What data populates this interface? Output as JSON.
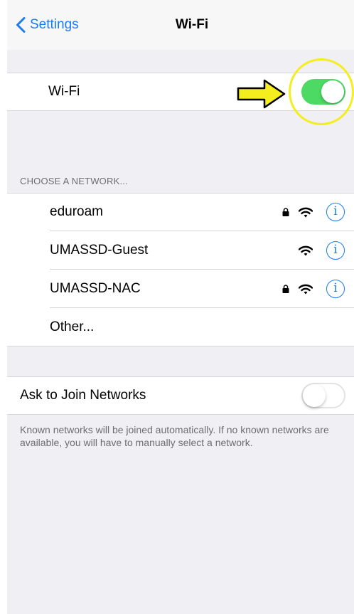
{
  "nav": {
    "back_label": "Settings",
    "title": "Wi-Fi"
  },
  "wifi": {
    "label": "Wi-Fi",
    "enabled": true
  },
  "annotation": {
    "arrow_color": "#f4ee1f",
    "ring_color": "#f4ee1f"
  },
  "networks": {
    "header": "CHOOSE A NETWORK...",
    "items": [
      {
        "name": "eduroam",
        "locked": true,
        "icons": [
          "lock-icon",
          "wifi-signal-icon",
          "info-icon"
        ]
      },
      {
        "name": "UMASSD-Guest",
        "locked": false,
        "icons": [
          "wifi-signal-icon",
          "info-icon"
        ]
      },
      {
        "name": "UMASSD-NAC",
        "locked": true,
        "icons": [
          "lock-icon",
          "wifi-signal-icon",
          "info-icon"
        ]
      }
    ],
    "other_label": "Other...",
    "info_glyph": "i"
  },
  "ask_to_join": {
    "label": "Ask to Join Networks",
    "enabled": false,
    "note": "Known networks will be joined automatically. If no known networks are available, you will have to manually select a network."
  },
  "colors": {
    "accent": "#1a7bf4",
    "toggle_on": "#4cd964",
    "background": "#efeff4"
  }
}
